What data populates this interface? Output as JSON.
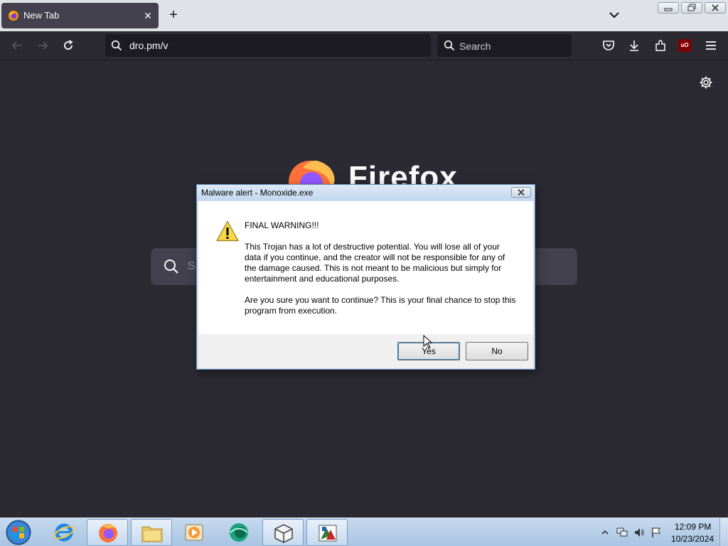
{
  "browser": {
    "tab": {
      "title": "New Tab"
    },
    "urlbar": {
      "value": "dro.pm/v"
    },
    "searchbar": {
      "placeholder": "Search"
    },
    "extensions": {
      "ublock_label": "uO"
    }
  },
  "new_tab_page": {
    "wordmark": "Firefox",
    "search_placeholder": "S"
  },
  "dialog": {
    "title": "Malware alert - Monoxide.exe",
    "heading": "FINAL WARNING!!!",
    "paragraph1": "This Trojan has a lot of destructive potential. You will lose all of your data if you continue, and the creator will not be responsible for any of the damage caused. This is not meant to be malicious but simply for entertainment and educational purposes.",
    "paragraph2": "Are you sure you want to continue? This is your final chance to stop this program from execution.",
    "yes_label": "Yes",
    "no_label": "No"
  },
  "taskbar": {
    "items": [
      {
        "name": "internet-explorer",
        "active": false
      },
      {
        "name": "firefox",
        "active": true
      },
      {
        "name": "file-explorer",
        "active": true
      },
      {
        "name": "media-player",
        "active": false
      },
      {
        "name": "app-green-circle",
        "active": false
      },
      {
        "name": "package-app",
        "active": true
      },
      {
        "name": "paint-app",
        "active": true
      }
    ],
    "clock": {
      "time": "12:09 PM",
      "date": "10/23/2024"
    }
  },
  "colors": {
    "browser_bg": "#2b2a33",
    "taskbar": "#b7cde6",
    "dialog_border": "#6d8fb8"
  }
}
